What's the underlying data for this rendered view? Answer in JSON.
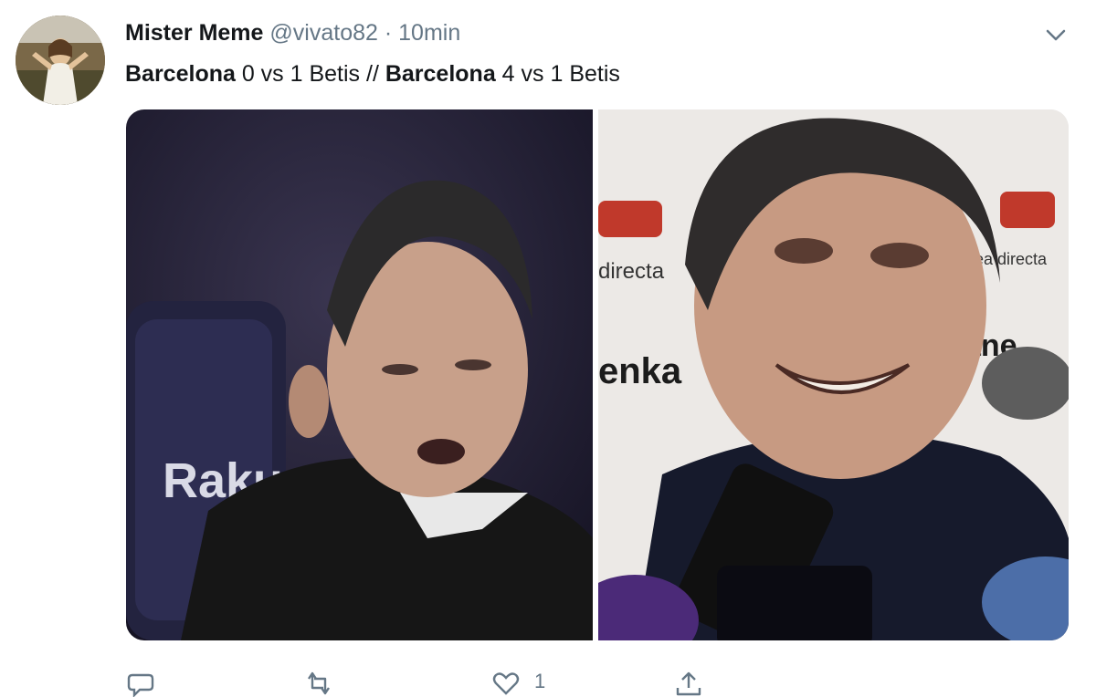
{
  "tweet": {
    "display_name": "Mister Meme",
    "handle": "@vivato82",
    "separator": "·",
    "time": "10min",
    "caption": [
      {
        "text": "Barcelona",
        "bold": true
      },
      {
        "text": " 0 vs 1 Betis // ",
        "bold": false
      },
      {
        "text": "Barcelona",
        "bold": true
      },
      {
        "text": " 4 vs 1 Betis",
        "bold": false
      }
    ],
    "photos": {
      "left_sign_text": "Raku",
      "right_sign_text_1": "directa",
      "right_sign_text_2": "enka",
      "right_sign_text_3": "ea directa",
      "right_sign_text_4": "ane"
    },
    "actions": {
      "reply_icon": "reply-icon",
      "retweet_icon": "retweet-icon",
      "like_icon": "heart-icon",
      "like_count": "1",
      "share_icon": "share-icon"
    }
  },
  "colors": {
    "text_primary": "#14171a",
    "text_secondary": "#657786"
  }
}
